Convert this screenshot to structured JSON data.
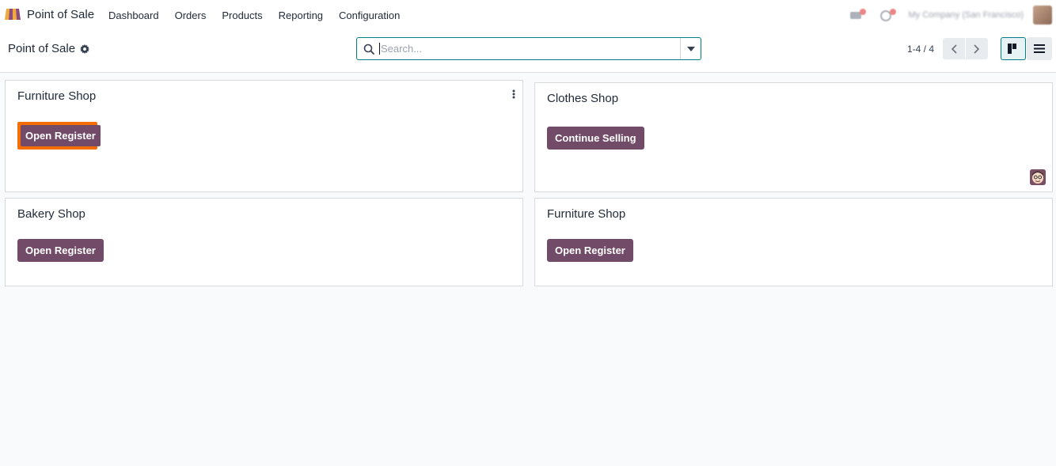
{
  "navbar": {
    "app_name": "Point of Sale",
    "menu": [
      "Dashboard",
      "Orders",
      "Products",
      "Reporting",
      "Configuration"
    ],
    "company_name": "My Company (San Francisco)",
    "brand_color": "#714b67",
    "accent_color": "#017e84"
  },
  "control_panel": {
    "breadcrumb": "Point of Sale",
    "search_placeholder": "Search...",
    "pager": "1-4 / 4"
  },
  "cards": [
    {
      "title": "Furniture Shop",
      "button": "Open Register",
      "highlighted": true,
      "has_menu": true,
      "has_avatar": false
    },
    {
      "title": "Clothes Shop",
      "button": "Continue Selling",
      "highlighted": false,
      "has_menu": false,
      "has_avatar": true
    },
    {
      "title": "Bakery Shop",
      "button": "Open Register",
      "highlighted": false,
      "has_menu": false,
      "has_avatar": false
    },
    {
      "title": "Furniture Shop",
      "button": "Open Register",
      "highlighted": false,
      "has_menu": false,
      "has_avatar": false
    }
  ],
  "colors": {
    "button": "#714b67",
    "highlight": "#f56e05",
    "background": "#f9fafb"
  }
}
